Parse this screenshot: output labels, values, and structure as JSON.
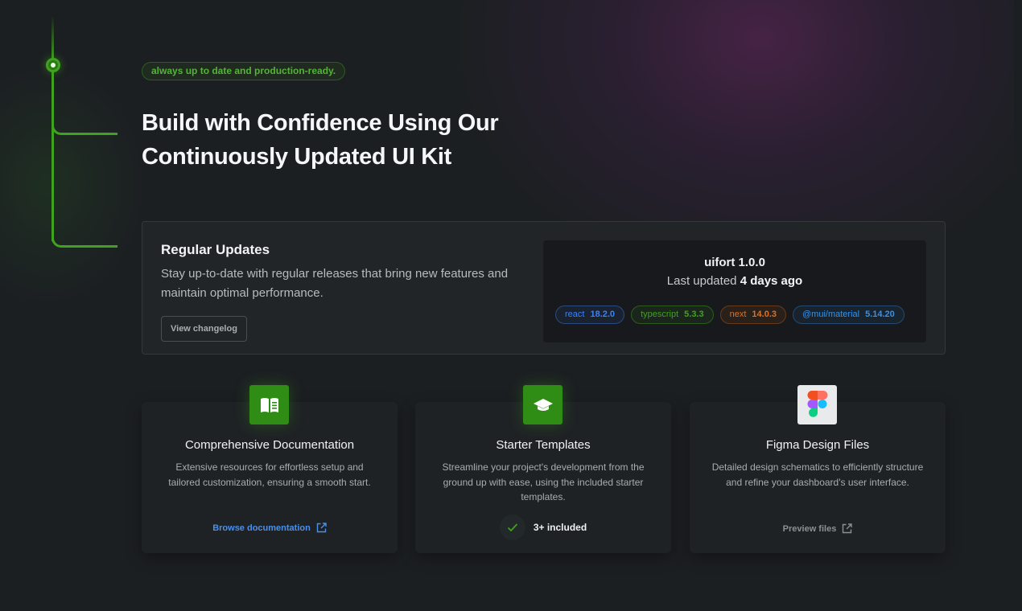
{
  "hero": {
    "chip": "always up to date and production-ready.",
    "title": "Build with Confidence Using Our Continuously Updated UI Kit"
  },
  "updates": {
    "title": "Regular Updates",
    "description": "Stay up-to-date with regular releases that bring new features and maintain optimal performance.",
    "changelog_button": "View changelog",
    "version": "uifort 1.0.0",
    "last_updated_prefix": "Last updated",
    "last_updated_value": "4 days ago",
    "dependencies": [
      {
        "name": "react",
        "version": "18.2.0",
        "color": "#3b82f6"
      },
      {
        "name": "typescript",
        "version": "5.3.3",
        "color": "#3fa31d"
      },
      {
        "name": "next",
        "version": "14.0.3",
        "color": "#e0701f"
      },
      {
        "name": "@mui/material",
        "version": "5.14.20",
        "color": "#3b90e0"
      }
    ]
  },
  "features": [
    {
      "title": "Comprehensive Documentation",
      "description": "Extensive resources for effortless setup and tailored customization, ensuring a smooth start.",
      "link": "Browse documentation",
      "icon": "book-icon"
    },
    {
      "title": "Starter Templates",
      "description": "Streamline your project's development from the ground up with ease, using the included starter templates.",
      "included": "3+ included",
      "icon": "graduation-cap-icon"
    },
    {
      "title": "Figma Design Files",
      "description": "Detailed design schematics to efficiently structure and refine your dashboard's user interface.",
      "link": "Preview files",
      "icon": "figma-icon"
    }
  ],
  "colors": {
    "accent_green": "#3fa31d",
    "link_blue": "#4c8fe8",
    "background": "#1c1f22"
  }
}
